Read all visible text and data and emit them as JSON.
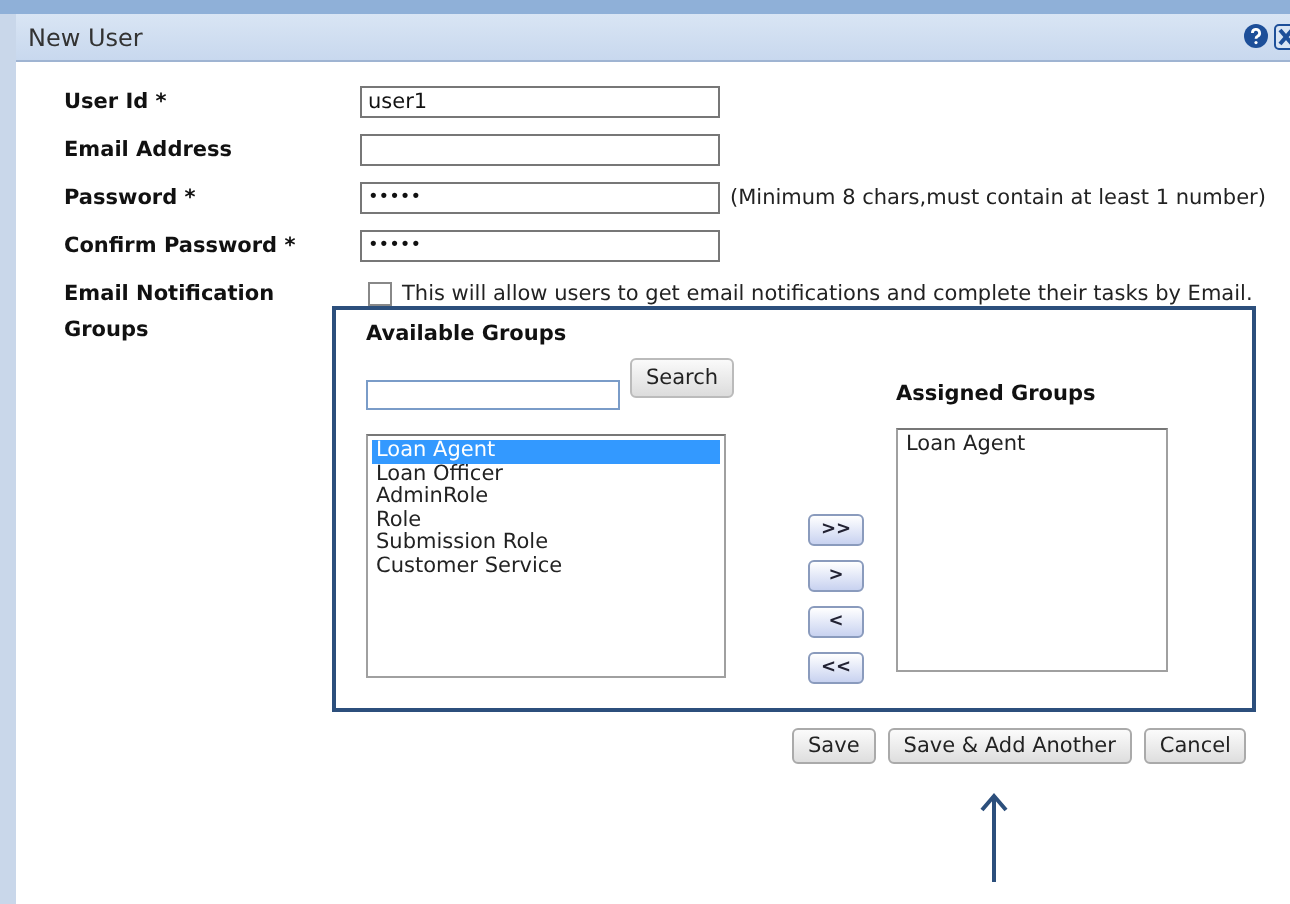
{
  "window": {
    "title": "New User"
  },
  "fields": [
    {
      "kind": "text",
      "label": "User Id *",
      "value": "user1"
    },
    {
      "kind": "text",
      "label": "Email Address"
    },
    {
      "kind": "password",
      "label": "Password *",
      "value": "•••••",
      "hint": "(Minimum 8 chars,must contain at least 1 number)"
    },
    {
      "kind": "password",
      "label": "Confirm Password *",
      "value": "•••••"
    },
    {
      "kind": "checkbox",
      "label": "Email Notification",
      "checked": false,
      "text": "This will allow users to get email notifications and complete their tasks by Email."
    }
  ],
  "groups": {
    "label": "Groups",
    "available_title": "Available Groups",
    "search_button": "Search",
    "available": [
      {
        "label": "Loan Agent",
        "selected": true
      },
      {
        "label": "Loan Officer",
        "selected": false
      },
      {
        "label": "AdminRole",
        "selected": false
      },
      {
        "label": "Role",
        "selected": false
      },
      {
        "label": "Submission Role",
        "selected": false
      },
      {
        "label": "Customer Service",
        "selected": false
      }
    ],
    "move_buttons": [
      ">>",
      ">",
      "<",
      "<<"
    ],
    "assigned_title": "Assigned Groups",
    "assigned": [
      {
        "label": "Loan Agent",
        "selected": false
      }
    ]
  },
  "buttons": [
    "Save",
    "Save & Add Another",
    "Cancel"
  ]
}
